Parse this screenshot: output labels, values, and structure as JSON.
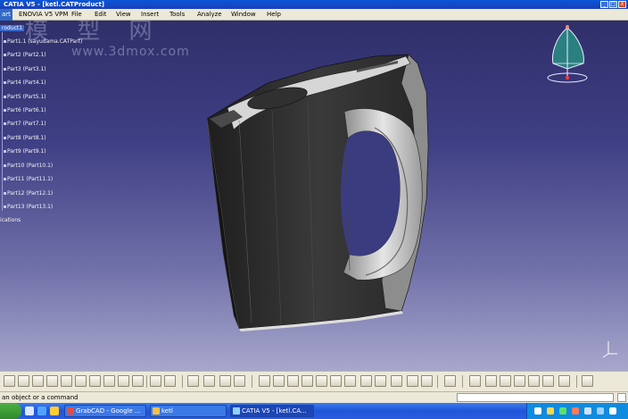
{
  "window": {
    "title": "CATIA V5 - [ketl.CATProduct]",
    "controls": [
      "_",
      "□",
      "x"
    ]
  },
  "menubar": {
    "items": [
      "art",
      "ENOVIA V5 VPM",
      "File",
      "Edit",
      "View",
      "Insert",
      "Tools",
      "Analyze",
      "Window",
      "Help"
    ]
  },
  "tree": {
    "root": "roduct1",
    "parts": [
      "Part1.1 (sayudama.CATPart)",
      "Part2 (Part2.1)",
      "Part3 (Part3.1)",
      "Part4 (Part4.1)",
      "Part5 (Part5.1)",
      "Part6 (Part6.1)",
      "Part7 (Part7.1)",
      "Part8 (Part8.1)",
      "Part9 (Part9.1)",
      "Part10 (Part10.1)",
      "Part11 (Part11.1)",
      "Part12 (Part12.1)",
      "Part13 (Part13.1)"
    ],
    "applications": "ications"
  },
  "watermark": {
    "chinese": "模 型 网",
    "url": "www.3dmox.com"
  },
  "statusbar": {
    "message": "an object or a command",
    "command_value": ""
  },
  "taskbar": {
    "buttons": [
      "GrabCAD - Google ...",
      "ketl",
      "CATIA V5 - [ketl.CA..."
    ]
  },
  "colors": {
    "viewport_top": "#2f2f6a",
    "viewport_bottom": "#a7a7cd",
    "model_dark": "#2e2e2e",
    "model_light": "#d8d8d8"
  },
  "icons": {
    "compass": "compass-icon",
    "axis": "axis-triad-icon"
  }
}
